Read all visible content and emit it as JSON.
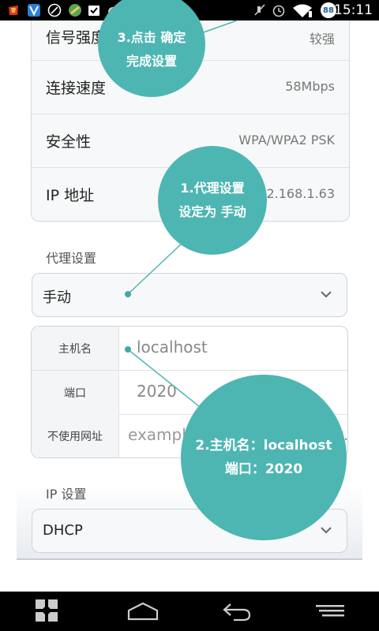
{
  "status_bar": {
    "time": "15:11",
    "battery_level": "88",
    "icons": [
      "app-icon-red",
      "app-icon-blue",
      "clock-app-icon",
      "map-app-icon",
      "checkbox-app-icon",
      "android-icon",
      "mute-icon",
      "alarm-icon",
      "wifi-icon"
    ]
  },
  "network_info": {
    "rows": [
      {
        "label": "信号强度",
        "value": "较强"
      },
      {
        "label": "连接速度",
        "value": "58Mbps"
      },
      {
        "label": "安全性",
        "value": "WPA/WPA2 PSK"
      },
      {
        "label": "IP 地址",
        "value": "192.168.1.63"
      }
    ]
  },
  "proxy": {
    "section_title": "代理设置",
    "selected": "手动",
    "hostname_label": "主机名",
    "hostname_value": "localhost",
    "port_label": "端口",
    "port_value": "2020",
    "bypass_label": "不使用网址",
    "bypass_placeholder": "example.com,mycomp.test.com,localhost"
  },
  "ip_settings": {
    "section_title": "IP 设置",
    "selected": "DHCP"
  },
  "annotations": {
    "step1_line1": "1.代理设置",
    "step1_line2": "设定为 手动",
    "step2_line1": "2.主机名：localhost",
    "step2_line2": "端口：2020",
    "step3_line1": "3.点击 确定",
    "step3_line2": "完成设置"
  },
  "colors": {
    "accent": "#4db6b2",
    "status_bar": "#000000",
    "battery_badge": "#1a5c9e"
  }
}
